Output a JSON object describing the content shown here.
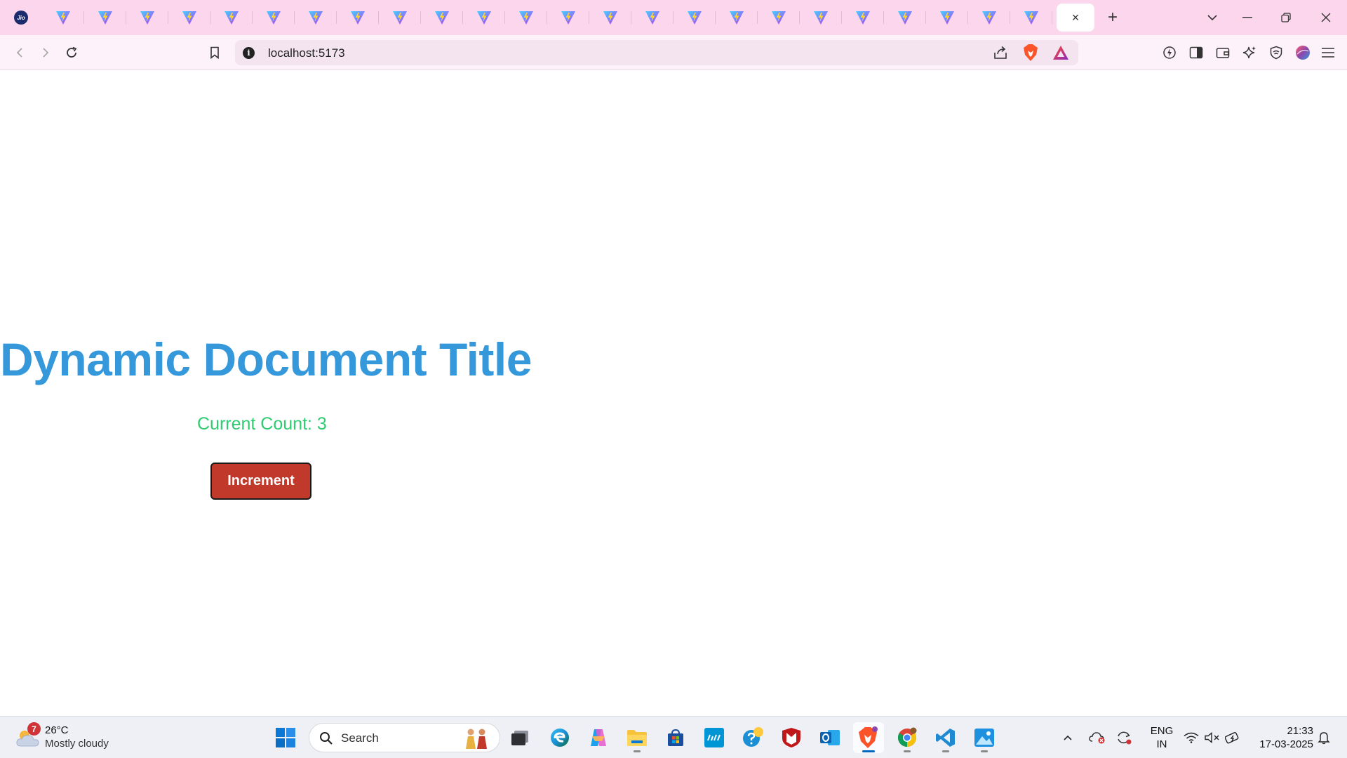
{
  "browser": {
    "tabs": {
      "first_tab_icon": "jio-logo-icon",
      "first_tab_logo_text": "Jio",
      "repeated_tab_icon": "vite-logo-icon",
      "repeated_tab_count": 24,
      "active_tab_close": "×"
    },
    "address_bar": {
      "url": "localhost:5173"
    }
  },
  "page": {
    "title": "Dynamic Document Title",
    "count_text": "Current Count: 3",
    "increment_label": "Increment",
    "colors": {
      "title": "#3498db",
      "count": "#2ecc71",
      "button": "#c0392b"
    }
  },
  "taskbar": {
    "weather": {
      "badge": "7",
      "temp": "26°C",
      "condition": "Mostly cloudy"
    },
    "search_label": "Search",
    "lang": {
      "line1": "ENG",
      "line2": "IN"
    },
    "clock": {
      "time": "21:33",
      "date": "17-03-2025"
    }
  }
}
